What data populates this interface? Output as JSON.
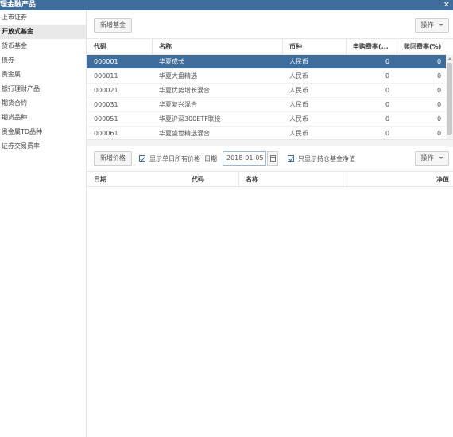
{
  "window": {
    "title": "理金融产品",
    "close": "✕"
  },
  "sidebar": {
    "items": [
      {
        "label": "上市证券",
        "active": false
      },
      {
        "label": "开放式基金",
        "active": true
      },
      {
        "label": "货币基金",
        "active": false
      },
      {
        "label": "债券",
        "active": false
      },
      {
        "label": "贵金属",
        "active": false
      },
      {
        "label": "银行理财产品",
        "active": false
      },
      {
        "label": "期货合约",
        "active": false
      },
      {
        "label": "期货品种",
        "active": false
      },
      {
        "label": "贵金属TD品种",
        "active": false
      },
      {
        "label": "证券交易费率",
        "active": false
      }
    ]
  },
  "toolbar1": {
    "add_fund": "新增基金",
    "ops": "操作"
  },
  "fund_grid": {
    "columns": [
      "代码",
      "名称",
      "币种",
      "申购费率(...",
      "赎回费率(%)"
    ],
    "rows": [
      {
        "code": "000001",
        "name": "华夏成长",
        "currency": "人民币",
        "buy_fee": "0",
        "redeem_fee": "0",
        "selected": true
      },
      {
        "code": "000011",
        "name": "华夏大盘精选",
        "currency": "人民币",
        "buy_fee": "0",
        "redeem_fee": "0",
        "selected": false
      },
      {
        "code": "000021",
        "name": "华夏优势增长混合",
        "currency": "人民币",
        "buy_fee": "0",
        "redeem_fee": "0",
        "selected": false
      },
      {
        "code": "000031",
        "name": "华夏复兴混合",
        "currency": "人民币",
        "buy_fee": "0",
        "redeem_fee": "0",
        "selected": false
      },
      {
        "code": "000051",
        "name": "华夏沪深300ETF联接",
        "currency": "人民币",
        "buy_fee": "0",
        "redeem_fee": "0",
        "selected": false
      },
      {
        "code": "000061",
        "name": "华夏盛世精选混合",
        "currency": "人民币",
        "buy_fee": "0",
        "redeem_fee": "0",
        "selected": false
      }
    ]
  },
  "toolbar2": {
    "add_price": "新增价格",
    "show_all_daily": "显示单日所有价格",
    "date_label": "日期",
    "date_value": "2018-01-05",
    "show_held_only": "只显示持仓基金净值",
    "ops": "操作"
  },
  "price_grid": {
    "columns": [
      "日期",
      "代码",
      "名称",
      "净值"
    ]
  },
  "colors": {
    "accent": "#3f6e9d",
    "selected_row": "#3f6e9d"
  }
}
